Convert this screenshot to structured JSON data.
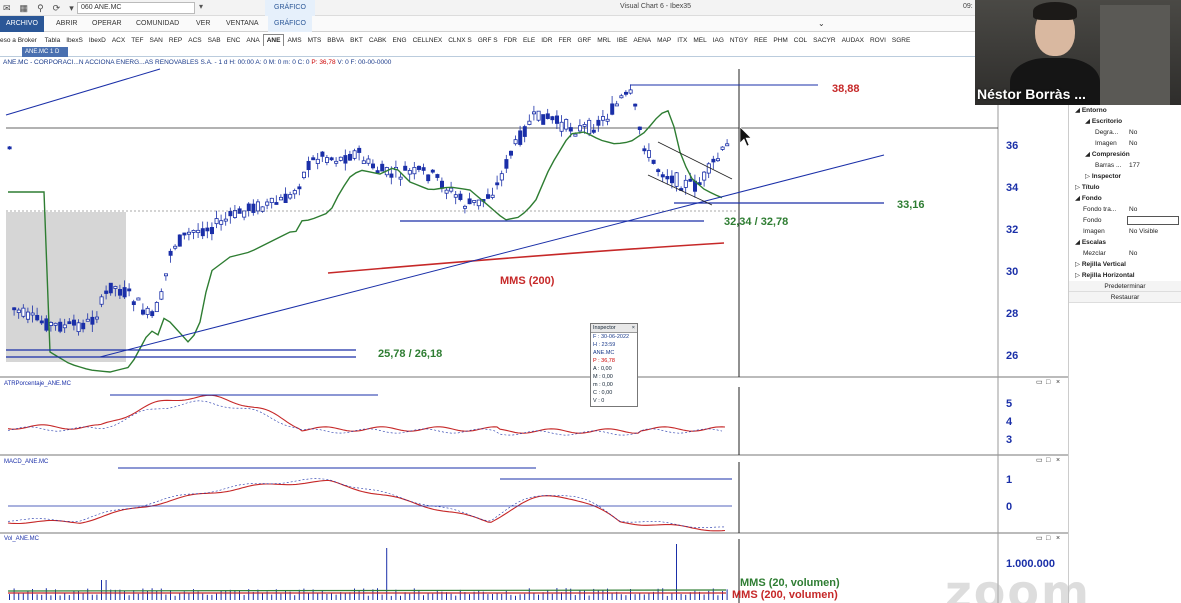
{
  "app": {
    "window_title": "Visual Chart 6 - Ibex35",
    "ticker_value": "060 ANE.MC",
    "context_tab": "GRÁFICO",
    "time_fragment": "09:",
    "menu": [
      "ARCHIVO",
      "ABRIR",
      "OPERAR",
      "COMUNIDAD",
      "VER",
      "VENTANA",
      "GRÁFICO"
    ],
    "symbols": [
      "Tabla",
      "IbexS",
      "IbexD",
      "ACX",
      "TEF",
      "SAN",
      "REP",
      "ACS",
      "SAB",
      "ENC",
      "ANA",
      "ANE",
      "AMS",
      "MTS",
      "BBVA",
      "BKT",
      "CABK",
      "ENG",
      "CELLNEX",
      "CLNX S",
      "GRF S",
      "FDR",
      "ELE",
      "IDR",
      "FER",
      "GRF",
      "MRL",
      "IBE",
      "AENA",
      "MAP",
      "ITX",
      "MEL",
      "IAG",
      "NTGY",
      "REE",
      "PHM",
      "COL",
      "SACYR",
      "AUDAX",
      "ROVI",
      "SGRE"
    ],
    "symbols_selected": "ANE",
    "symbols_prefix": "eso a Broker",
    "chart_tab": "ANE.MC 1 D",
    "info_line_prefix": "ANE.MC - CORPORACI...N ACCIONA ENERG...AS RENOVABLES S.A. - 1 d H: 00:00 A: 0 M: 0 m: 0 C: 0",
    "info_line_red": "P: 36,78",
    "info_line_suffix": "V: 0 F: 00-00-0000"
  },
  "chart_data": {
    "type": "candlestick",
    "price_axis_ticks": [
      36,
      34,
      32,
      30,
      28,
      26
    ],
    "annotations": {
      "resistance": "38,88",
      "support": "33,16",
      "support_zone": "32,34 / 32,78",
      "mms200": "MMS (200)",
      "lower_zone": "25,78 / 26,18"
    },
    "atr_panel": {
      "title": "ATRPorcentaje_ANE.MC",
      "ticks": [
        5,
        4,
        3
      ]
    },
    "macd_panel": {
      "title": "MACD_ANE.MC",
      "ticks": [
        1,
        0
      ]
    },
    "vol_panel": {
      "title": "Vol_ANE.MC",
      "tick": "1.000.000",
      "label_green": "MMS (20, volumen)",
      "label_red": "MMS (200, volumen)"
    },
    "colors": {
      "candle": "#1a2fa8",
      "mms50": "#2e7d32",
      "mms200": "#c62828",
      "lines": "#1a2fa8"
    }
  },
  "inspector": {
    "title": "Inspector",
    "lines": [
      "F : 30-06-2022",
      "H : 23:59",
      "ANE.MC",
      "P : 36,78",
      "A : 0,00",
      "M : 0,00",
      "m : 0,00",
      "C : 0,00",
      "V : 0"
    ]
  },
  "right_panel": {
    "entorno": "Entorno",
    "escritorio": "Escritorio",
    "degradado": "Degra...",
    "degradado_val": "No",
    "imagen": "Imagen",
    "imagen_val": "No",
    "compresion": "Compresión",
    "barras": "Barras ...",
    "barras_val": "177",
    "inspector": "Inspector",
    "titulo": "Título",
    "fondo": "Fondo",
    "fondo_tra": "Fondo tra...",
    "fondo_tra_val": "No",
    "fondo2": "Fondo",
    "imagen2": "Imagen",
    "imagen2_val": "No Visible",
    "escalas": "Escalas",
    "mezclar": "Mezclar",
    "mezclar_val": "No",
    "rejilla_v": "Rejilla Vertical",
    "rejilla_h": "Rejilla Horizontal",
    "predeterminar": "Predeterminar",
    "restaurar": "Restaurar"
  },
  "webcam": {
    "name": "Néstor Borràs ..."
  },
  "watermark": "zoom"
}
